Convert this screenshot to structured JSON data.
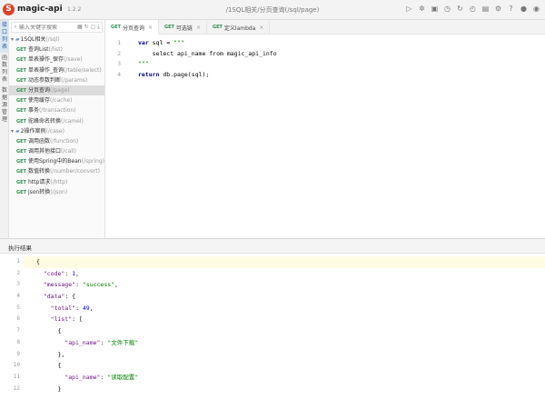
{
  "header": {
    "logo_letter": "S",
    "app_name": "magic-api",
    "version": "1.2.2",
    "path": "/1SQL相关/分页查询(/sql/page)",
    "tools": [
      "run-icon",
      "debug-icon",
      "save-icon",
      "history-icon",
      "refresh-icon",
      "clock-icon",
      "book-icon",
      "gear-icon",
      "help-icon",
      "github-icon",
      "gitee-icon"
    ]
  },
  "left_strip": {
    "tabs": [
      {
        "label": "接口列表",
        "active": true
      },
      {
        "label": "函数列表",
        "active": false
      },
      {
        "label": "数据源管理",
        "active": false
      }
    ]
  },
  "tree": {
    "search_placeholder": "输入关键字搜索",
    "rows": [
      {
        "type": "group",
        "label": "1SQL相关",
        "path": "(/sql)"
      },
      {
        "type": "item",
        "method": "GET",
        "label": "查询List",
        "path": "(/list)"
      },
      {
        "type": "item",
        "method": "GET",
        "label": "单表操作_保存",
        "path": "(/save)"
      },
      {
        "type": "item",
        "method": "GET",
        "label": "单表操作_查询",
        "path": "(/table/select)"
      },
      {
        "type": "item",
        "method": "GET",
        "label": "动态参数判断",
        "path": "(/params)"
      },
      {
        "type": "item",
        "method": "GET",
        "label": "分页查询",
        "path": "(/page)",
        "selected": true
      },
      {
        "type": "item",
        "method": "GET",
        "label": "使用缓存",
        "path": "(/cache)"
      },
      {
        "type": "item",
        "method": "GET",
        "label": "事务",
        "path": "(/transaction)"
      },
      {
        "type": "item",
        "method": "GET",
        "label": "驼峰命名转换",
        "path": "(/camel)"
      },
      {
        "type": "group",
        "label": "2操作案例",
        "path": "(/case)"
      },
      {
        "type": "item",
        "method": "GET",
        "label": "调用函数",
        "path": "(/function)"
      },
      {
        "type": "item",
        "method": "GET",
        "label": "调用其他接口",
        "path": "(/call)"
      },
      {
        "type": "item",
        "method": "GET",
        "label": "使用Spring中的Bean",
        "path": "(/spring)"
      },
      {
        "type": "item",
        "method": "GET",
        "label": "数值转换",
        "path": "(/number/convert)"
      },
      {
        "type": "item",
        "method": "GET",
        "label": "http请求",
        "path": "(/http)"
      },
      {
        "type": "item",
        "method": "GET",
        "label": "json转换",
        "path": "(/json)"
      }
    ]
  },
  "editor_tabs": [
    {
      "method": "GET",
      "label": "分页查询",
      "active": true
    },
    {
      "method": "GET",
      "label": "可选链",
      "active": false
    },
    {
      "method": "GET",
      "label": "定义lambda",
      "active": false
    }
  ],
  "editor": {
    "line_numbers": [
      "1",
      "2",
      "3",
      "4"
    ],
    "lines": [
      [
        {
          "t": "var",
          "c": "kw"
        },
        {
          "t": " sql = ",
          "c": ""
        },
        {
          "t": "\"\"\"",
          "c": "str"
        }
      ],
      [
        {
          "t": "    select api_name from magic_api_info",
          "c": ""
        }
      ],
      [
        {
          "t": "\"\"\"",
          "c": "str"
        }
      ],
      [
        {
          "t": "return",
          "c": "kw"
        },
        {
          "t": " db.page(sql);",
          "c": ""
        }
      ]
    ]
  },
  "result": {
    "title": "执行结果",
    "line_numbers": [
      "1",
      "2",
      "3",
      "4",
      "5",
      "6",
      "7",
      "8",
      "9",
      "10",
      "11",
      "12"
    ],
    "lines": [
      [
        {
          "t": "{",
          "c": ""
        }
      ],
      [
        {
          "t": "  ",
          "c": ""
        },
        {
          "t": "\"code\"",
          "c": "key"
        },
        {
          "t": ": ",
          "c": ""
        },
        {
          "t": "1",
          "c": "jnum"
        },
        {
          "t": ",",
          "c": ""
        }
      ],
      [
        {
          "t": "  ",
          "c": ""
        },
        {
          "t": "\"message\"",
          "c": "key"
        },
        {
          "t": ": ",
          "c": ""
        },
        {
          "t": "\"success\"",
          "c": "jstr"
        },
        {
          "t": ",",
          "c": ""
        }
      ],
      [
        {
          "t": "  ",
          "c": ""
        },
        {
          "t": "\"data\"",
          "c": "key"
        },
        {
          "t": ": {",
          "c": ""
        }
      ],
      [
        {
          "t": "    ",
          "c": ""
        },
        {
          "t": "\"total\"",
          "c": "key"
        },
        {
          "t": ": ",
          "c": ""
        },
        {
          "t": "49",
          "c": "jnum"
        },
        {
          "t": ",",
          "c": ""
        }
      ],
      [
        {
          "t": "    ",
          "c": ""
        },
        {
          "t": "\"list\"",
          "c": "key"
        },
        {
          "t": ": [",
          "c": ""
        }
      ],
      [
        {
          "t": "      {",
          "c": ""
        }
      ],
      [
        {
          "t": "        ",
          "c": ""
        },
        {
          "t": "\"api_name\"",
          "c": "key"
        },
        {
          "t": ": ",
          "c": ""
        },
        {
          "t": "\"文件下载\"",
          "c": "jstr"
        }
      ],
      [
        {
          "t": "      },",
          "c": ""
        }
      ],
      [
        {
          "t": "      {",
          "c": ""
        }
      ],
      [
        {
          "t": "        ",
          "c": ""
        },
        {
          "t": "\"api_name\"",
          "c": "key"
        },
        {
          "t": ": ",
          "c": ""
        },
        {
          "t": "\"读取配置\"",
          "c": "jstr"
        }
      ],
      [
        {
          "t": "      }",
          "c": ""
        }
      ]
    ]
  }
}
